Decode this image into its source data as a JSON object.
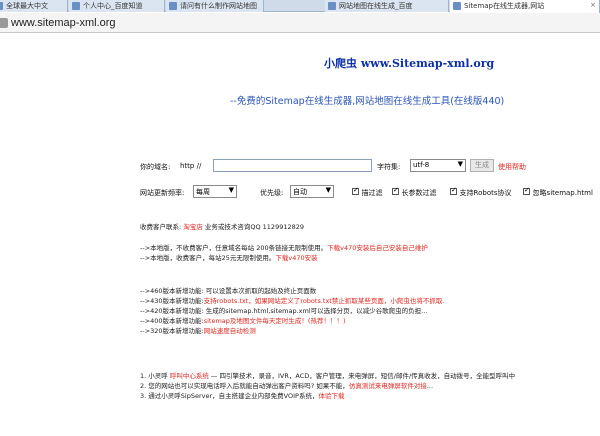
{
  "browser": {
    "tabs": [
      {
        "label": "全球最大中文",
        "active": false
      },
      {
        "label": "个人中心_百度知道",
        "active": false
      },
      {
        "label": "请问有什么制作网站地图",
        "active": false
      },
      {
        "label": "网站地图在线生成_百度",
        "active": false
      },
      {
        "label": "Sitemap在线生成器,网站",
        "active": true
      }
    ],
    "tab_close": "×",
    "address": "www.sitemap-xml.org"
  },
  "header": {
    "title": "小爬虫 www.Sitemap-xml.org",
    "subtitle": "--免费的Sitemap在线生成器,网站地图在线生成工具(在线版440)"
  },
  "form": {
    "site_label": "你的域名:",
    "http_prefix": "http //",
    "url_value": "",
    "charset_label": "字符集:",
    "charset_value": "utf-8",
    "generate_button": "生成",
    "help_link": "使用帮助",
    "freq_label": "网站更新频率:",
    "freq_value": "每周",
    "priority_label": "优先级:",
    "priority_value": "自动",
    "options": [
      {
        "label": "描过滤",
        "checked": true
      },
      {
        "label": "长参数过滤",
        "checked": true
      },
      {
        "label": "支持Robots协议",
        "checked": true
      },
      {
        "label": "忽略sitemap.html",
        "checked": true
      }
    ]
  },
  "info": {
    "contact_prefix": "收费客户联系:",
    "contact_link": "淘宝店",
    "contact_suffix": "业务或技术咨询QQ 1129912829",
    "line1_text": "-->本地版，不收费客户，任意域名每站 200条链接无限制使用。",
    "line1_link": "下载v470安装后自己安装自己维护",
    "line2_text": "-->本地版，收费客户，每站25元无限制使用。",
    "line2_link": "下载v470安装"
  },
  "updates": [
    {
      "text": "-->460版本新增功能: 可以设置本次抓取的起始及终止页面数",
      "link": ""
    },
    {
      "text": "-->430版本新增功能:",
      "link": "支持robots.txt，如果网站定义了robots.txt禁止抓取某些页面，小爬虫也将不抓取."
    },
    {
      "text": "-->420版本新增功能: 生成的sitemap.html,sitemap.xml可以选择分页，以减少谷歌爬虫的负担...",
      "link": ""
    },
    {
      "text": "-->400版本新增功能:",
      "link": "sitemap及地图文件每天定时生成！(热荐！！！)"
    },
    {
      "text": "-->320版本新增功能:",
      "link": "网站速度自动检测"
    }
  ],
  "ads": [
    {
      "num": "1.",
      "text": "小灵呼",
      "link": "呼叫中心系统",
      "rest": " — 四引擎技术，录音，IVR，ACD，客户管理，来电弹屏，短信/邮件/传真收发，自动拨号，全能型呼叫中"
    },
    {
      "num": "2.",
      "text": "您的网站也可以实现电话呼入后就能自动弹出客户资料吗? 如果不能，",
      "link": "仿真测试来电弹屏软件对接",
      "rest": "..."
    },
    {
      "num": "3.",
      "text": "通过小灵呼SipServer，自主搭建企业内部免费VOIP系统，",
      "link": "体验下载",
      "rest": ""
    }
  ]
}
